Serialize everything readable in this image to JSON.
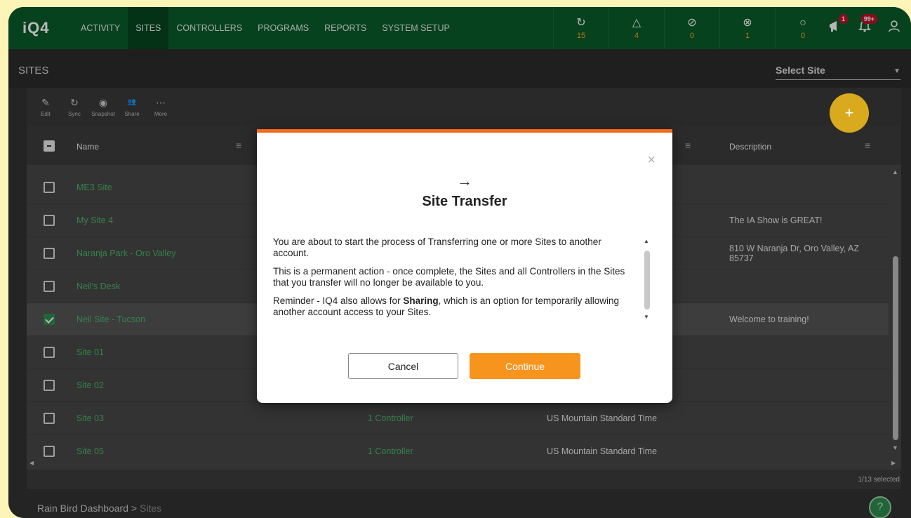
{
  "logo": "iQ4",
  "nav": {
    "items": [
      {
        "label": "ACTIVITY",
        "active": false
      },
      {
        "label": "SITES",
        "active": true
      },
      {
        "label": "CONTROLLERS",
        "active": false
      },
      {
        "label": "PROGRAMS",
        "active": false
      },
      {
        "label": "REPORTS",
        "active": false
      },
      {
        "label": "SYSTEM SETUP",
        "active": false
      }
    ],
    "status": [
      {
        "icon": "sync-icon",
        "glyph": "↻",
        "count": "15"
      },
      {
        "icon": "warning-icon",
        "glyph": "△",
        "count": "4"
      },
      {
        "icon": "disabled-icon",
        "glyph": "⊘",
        "count": "0"
      },
      {
        "icon": "error-icon",
        "glyph": "⊗",
        "count": "1"
      },
      {
        "icon": "offline-icon",
        "glyph": "○",
        "count": "0"
      }
    ],
    "announcements_badge": "1",
    "notifications_badge": "99+"
  },
  "page": {
    "title": "SITES",
    "select_site_label": "Select Site"
  },
  "toolbar": {
    "tools": [
      {
        "label": "Edit",
        "glyph": "✎"
      },
      {
        "label": "Sync",
        "glyph": "↻"
      },
      {
        "label": "Snapshot",
        "glyph": "◉"
      },
      {
        "label": "Share",
        "glyph": "👥"
      },
      {
        "label": "More",
        "glyph": "⋯"
      }
    ],
    "add_glyph": "+"
  },
  "table": {
    "headers": {
      "name": "Name",
      "description": "Description"
    },
    "rows": [
      {
        "name": "ME3 Site",
        "controllers": "",
        "timezone": "",
        "description": "",
        "checked": false
      },
      {
        "name": "My Site 4",
        "controllers": "",
        "timezone": "",
        "description": "The IA Show is GREAT!",
        "checked": false
      },
      {
        "name": "Naranja Park - Oro Valley",
        "controllers": "",
        "timezone": "",
        "description": "810 W Naranja Dr, Oro Valley, AZ 85737",
        "checked": false
      },
      {
        "name": "Neil's Desk",
        "controllers": "",
        "timezone": "",
        "description": "",
        "checked": false
      },
      {
        "name": "Neil Site - Tucson",
        "controllers": "",
        "timezone": "",
        "description": "Welcome to training!",
        "checked": true
      },
      {
        "name": "Site 01",
        "controllers": "",
        "timezone": "",
        "description": "",
        "checked": false
      },
      {
        "name": "Site 02",
        "controllers": "",
        "timezone": "",
        "description": "",
        "checked": false
      },
      {
        "name": "Site 03",
        "controllers": "1 Controller",
        "timezone": "US Mountain Standard Time",
        "description": "",
        "checked": false
      },
      {
        "name": "Site 05",
        "controllers": "1 Controller",
        "timezone": "US Mountain Standard Time",
        "description": "",
        "checked": false
      }
    ],
    "selection_count": "1/13 selected"
  },
  "breadcrumb": {
    "root": "Rain Bird Dashboard",
    "separator": ">",
    "current": "Sites"
  },
  "modal": {
    "arrow": "→",
    "title": "Site Transfer",
    "paragraph1": "You are about to start the process of Transferring one or more Sites to another account.",
    "paragraph2": "This is a permanent action - once complete, the Sites and all Controllers in the Sites that you transfer will no longer be available to you.",
    "paragraph3_before": "Reminder - IQ4 also allows for ",
    "paragraph3_bold": "Sharing",
    "paragraph3_after": ", which is an option for temporarily allowing another account access to your Sites.",
    "cancel_label": "Cancel",
    "continue_label": "Continue",
    "close_glyph": "×"
  },
  "colors": {
    "nav_green": "#0b5c2c",
    "accent_orange": "#f7941e",
    "link_green": "#4cb56a",
    "fab_yellow": "#d9a91e"
  }
}
